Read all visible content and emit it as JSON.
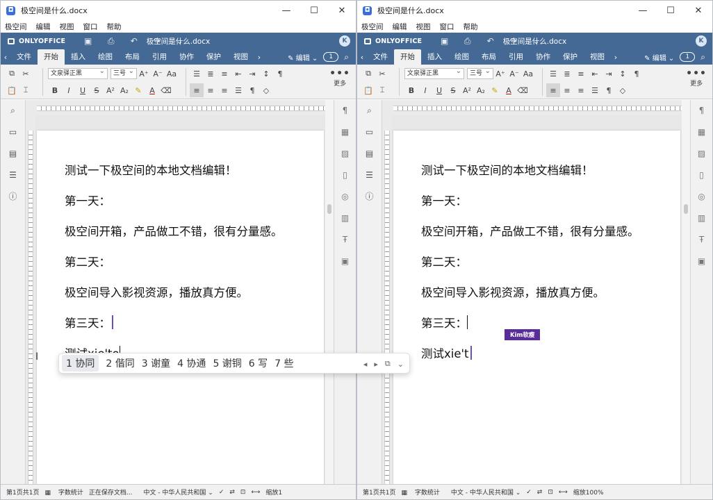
{
  "windows": [
    {
      "id": "left",
      "window_title": "极空间是什么.docx",
      "menu": [
        "极空间",
        "编辑",
        "视图",
        "窗口",
        "帮助"
      ],
      "brand": "ONLYOFFICE",
      "doc_title": "极空间是什么.docx",
      "avatar": "K",
      "tabs": [
        "文件",
        "开始",
        "插入",
        "绘图",
        "布局",
        "引用",
        "协作",
        "保护",
        "视图"
      ],
      "active_tab": "开始",
      "edit_mode": "编辑",
      "user_count": "1",
      "font_name": "文泉驿正黑",
      "font_size": "三号",
      "more_label": "更多",
      "paragraphs": [
        "测试一下极空间的本地文档编辑！",
        "第一天：",
        "极空间开箱，产品做工不错，很有分量感。",
        "第二天：",
        "极空间导入影视资源，播放真方便。",
        "第三天："
      ],
      "typing_line": "测试xie'to",
      "collab_label": "",
      "status": {
        "page": "第1页共1页",
        "wordcount": "字数统计",
        "saving": "正在保存文档...",
        "lang": "中文 - 中华人民共和国",
        "zoom": "缩放1"
      },
      "ime": {
        "candidates": [
          "1 协同",
          "2 偕同",
          "3 谢童",
          "4 协通",
          "5 谢铜",
          "6 写",
          "7 些"
        ]
      }
    },
    {
      "id": "right",
      "window_title": "极空间是什么.docx",
      "menu": [
        "极空间",
        "编辑",
        "视图",
        "窗口",
        "帮助"
      ],
      "brand": "ONLYOFFICE",
      "doc_title": "极空间是什么.docx",
      "avatar": "K",
      "tabs": [
        "文件",
        "开始",
        "插入",
        "绘图",
        "布局",
        "引用",
        "协作",
        "保护",
        "视图"
      ],
      "active_tab": "开始",
      "edit_mode": "编辑",
      "user_count": "1",
      "font_name": "文泉驿正黑",
      "font_size": "三号",
      "more_label": "更多",
      "paragraphs": [
        "测试一下极空间的本地文档编辑！",
        "第一天：",
        "极空间开箱，产品做工不错，很有分量感。",
        "第二天：",
        "极空间导入影视资源，播放真方便。",
        "第三天："
      ],
      "typing_line": "测试xie't",
      "collab_label": "Kim软瘦",
      "status": {
        "page": "第1页共1页",
        "wordcount": "字数统计",
        "saving": "",
        "lang": "中文 - 中华人民共和国",
        "zoom": "缩放100%"
      }
    }
  ],
  "colors": {
    "onlyoffice_header": "#446995",
    "collab_cursor": "#5a2e99",
    "toolbar_bg": "#f1f1f1"
  }
}
